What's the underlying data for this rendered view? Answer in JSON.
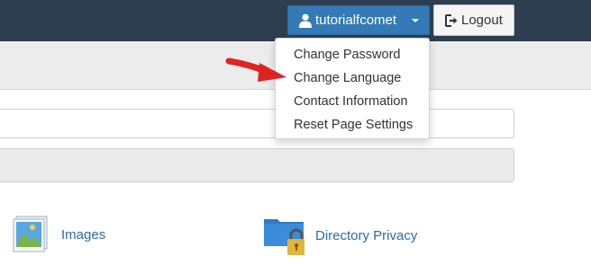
{
  "header": {
    "username": "tutorialfcomet",
    "logout_label": "Logout"
  },
  "user_menu": {
    "items": [
      {
        "label": "Change Password"
      },
      {
        "label": "Change Language"
      },
      {
        "label": "Contact Information"
      },
      {
        "label": "Reset Page Settings"
      }
    ]
  },
  "tools": {
    "images_label": "Images",
    "directory_privacy_label": "Directory Privacy"
  },
  "colors": {
    "navbar": "#2d3e50",
    "user_button": "#337ab7",
    "link": "#2d6aab",
    "annotation_arrow": "#e02222"
  },
  "icons": {
    "user": "user-icon",
    "logout": "logout-icon",
    "images": "images-icon",
    "directory_privacy": "folder-lock-icon",
    "arrow": "red-arrow-annotation"
  }
}
